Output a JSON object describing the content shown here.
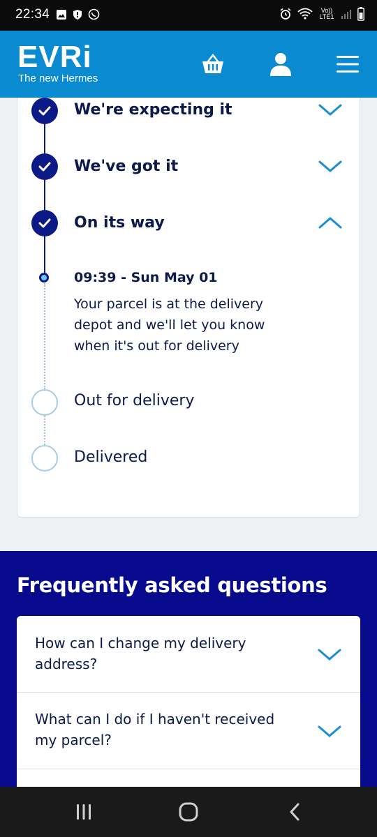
{
  "status_bar": {
    "time": "22:34",
    "network_label": "Vo)) LTE1"
  },
  "header": {
    "logo": "EVRi",
    "tagline": "The new Hermes",
    "icons": [
      "basket-icon",
      "account-icon",
      "menu-icon"
    ],
    "background_color": "#0a8ad0"
  },
  "tracking": {
    "steps": [
      {
        "label": "We're expecting it",
        "status": "done",
        "expanded": false
      },
      {
        "label": "We've got it",
        "status": "done",
        "expanded": false
      },
      {
        "label": "On its way",
        "status": "done",
        "expanded": true
      },
      {
        "label": "Out for delivery",
        "status": "pending"
      },
      {
        "label": "Delivered",
        "status": "pending"
      }
    ],
    "event": {
      "time": "09:39 - Sun May 01",
      "description": "Your parcel is at the delivery depot and we'll let you know when it's out for delivery"
    },
    "accent_color": "#0b1a86"
  },
  "faq": {
    "title": "Frequently asked questions",
    "items": [
      {
        "question": "How can I change my delivery address?"
      },
      {
        "question": "What can I do if I haven't received my parcel?"
      }
    ],
    "background_color": "#070a8c"
  },
  "nav_bar": {
    "buttons": [
      "recent-apps-icon",
      "home-icon",
      "back-icon"
    ]
  }
}
